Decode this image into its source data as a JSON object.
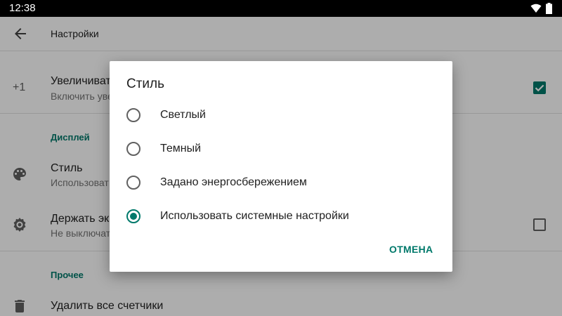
{
  "status_bar": {
    "time": "12:38",
    "icons": [
      "wifi-icon",
      "battery-icon"
    ]
  },
  "app_bar": {
    "title": "Настройки",
    "back_icon": "arrow-back-icon"
  },
  "settings": {
    "row1": {
      "icon": "+1",
      "title": "Увеличивать",
      "subtitle": "Включить уве",
      "checked": true
    },
    "section_display": "Дисплей",
    "row_style": {
      "icon": "palette-icon",
      "title": "Стиль",
      "subtitle": "Использоват"
    },
    "row_keep": {
      "icon": "gear-icon",
      "title": "Держать эк",
      "subtitle": "Не выключат",
      "checked": false
    },
    "section_other": "Прочее",
    "row_delete": {
      "icon": "trash-icon",
      "title": "Удалить все счетчики"
    }
  },
  "dialog": {
    "title": "Стиль",
    "options": [
      {
        "label": "Светлый",
        "selected": false
      },
      {
        "label": "Темный",
        "selected": false
      },
      {
        "label": "Задано энергосбережением",
        "selected": false
      },
      {
        "label": "Использовать системные настройки",
        "selected": true
      }
    ],
    "cancel_label": "ОТМЕНА"
  },
  "colors": {
    "accent": "#00796b",
    "statusbar": "#000000",
    "scrim": "rgba(0,0,0,0.32)"
  }
}
